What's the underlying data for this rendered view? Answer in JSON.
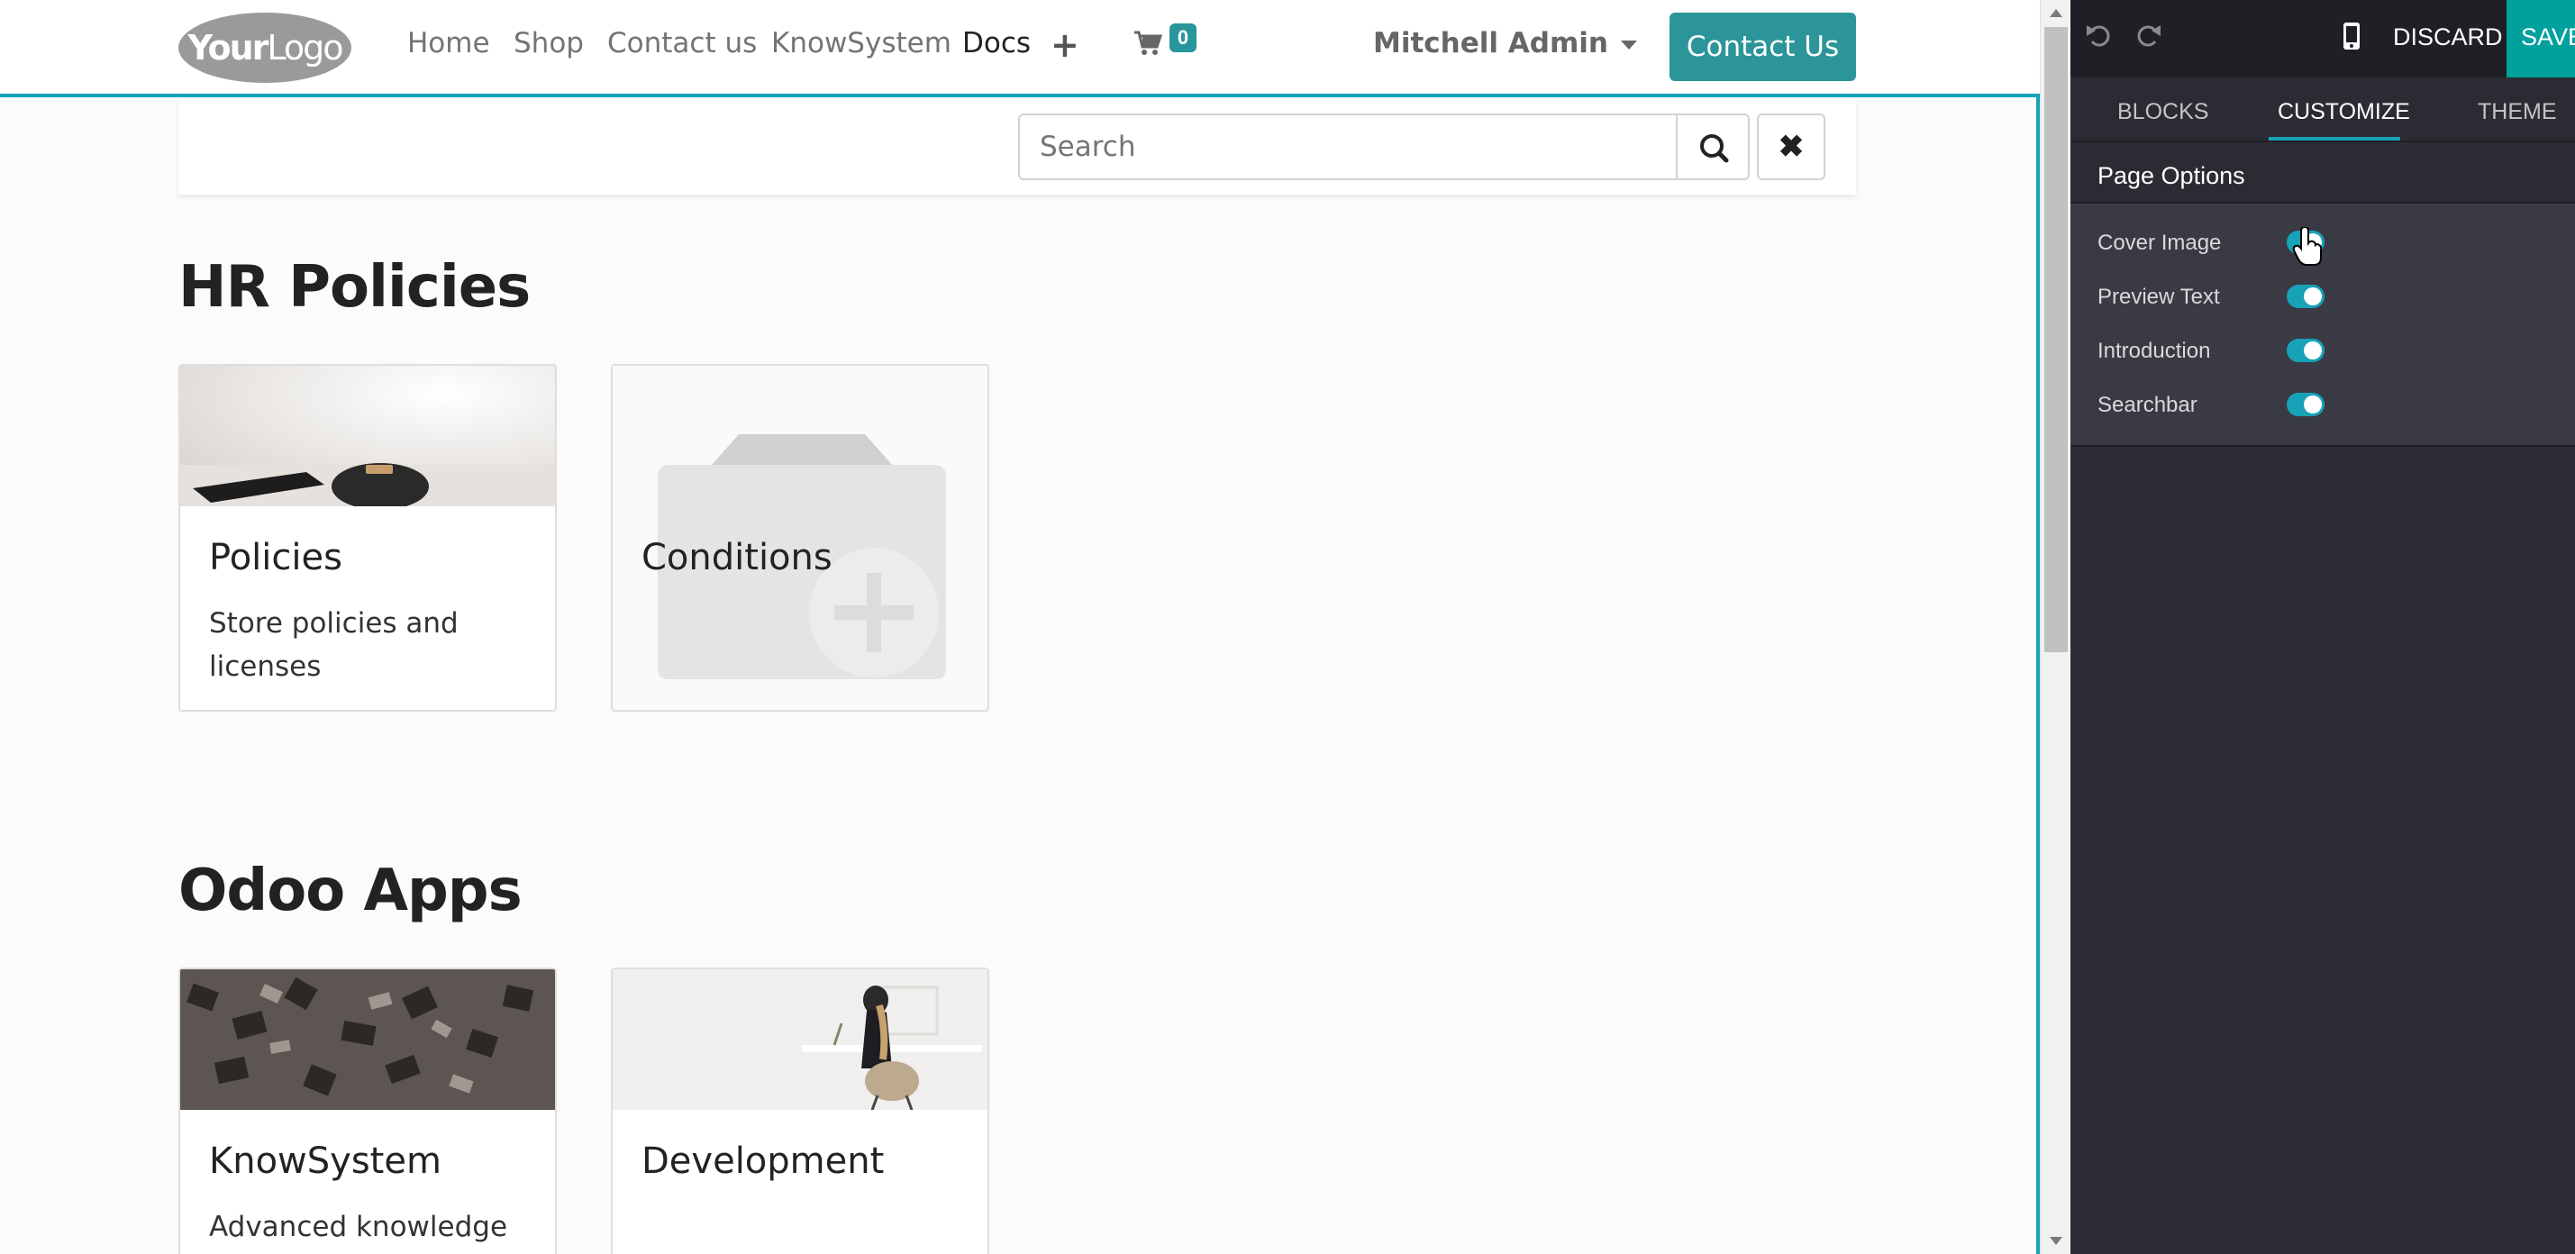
{
  "navbar": {
    "logo_bold": "Your",
    "logo_thin": "Logo",
    "links": [
      "Home",
      "Shop",
      "Contact us",
      "KnowSystem",
      "Docs"
    ],
    "active_link": "Docs",
    "cart_count": "0",
    "user": "Mitchell Admin",
    "cta": "Contact Us"
  },
  "search": {
    "placeholder": "Search"
  },
  "sections": [
    {
      "title": "HR Policies",
      "cards": [
        {
          "title": "Policies",
          "description": "Store policies and licenses"
        },
        {
          "title": "Conditions",
          "description": ""
        }
      ]
    },
    {
      "title": "Odoo Apps",
      "cards": [
        {
          "title": "KnowSystem",
          "description": "Advanced knowledge"
        },
        {
          "title": "Development",
          "description": ""
        }
      ]
    }
  ],
  "editor": {
    "discard": "DISCARD",
    "save": "SAVE",
    "tabs": [
      "BLOCKS",
      "CUSTOMIZE",
      "THEME"
    ],
    "active_tab": "CUSTOMIZE",
    "panel_title": "Page Options",
    "options": [
      {
        "label": "Cover Image",
        "enabled": true
      },
      {
        "label": "Preview Text",
        "enabled": true
      },
      {
        "label": "Introduction",
        "enabled": true
      },
      {
        "label": "Searchbar",
        "enabled": true
      }
    ],
    "accent_color": "#17a2b8"
  },
  "colors": {
    "primary_button": "#2b9599",
    "editor_bg": "#2b2b33",
    "save_bg": "#00a09d"
  }
}
